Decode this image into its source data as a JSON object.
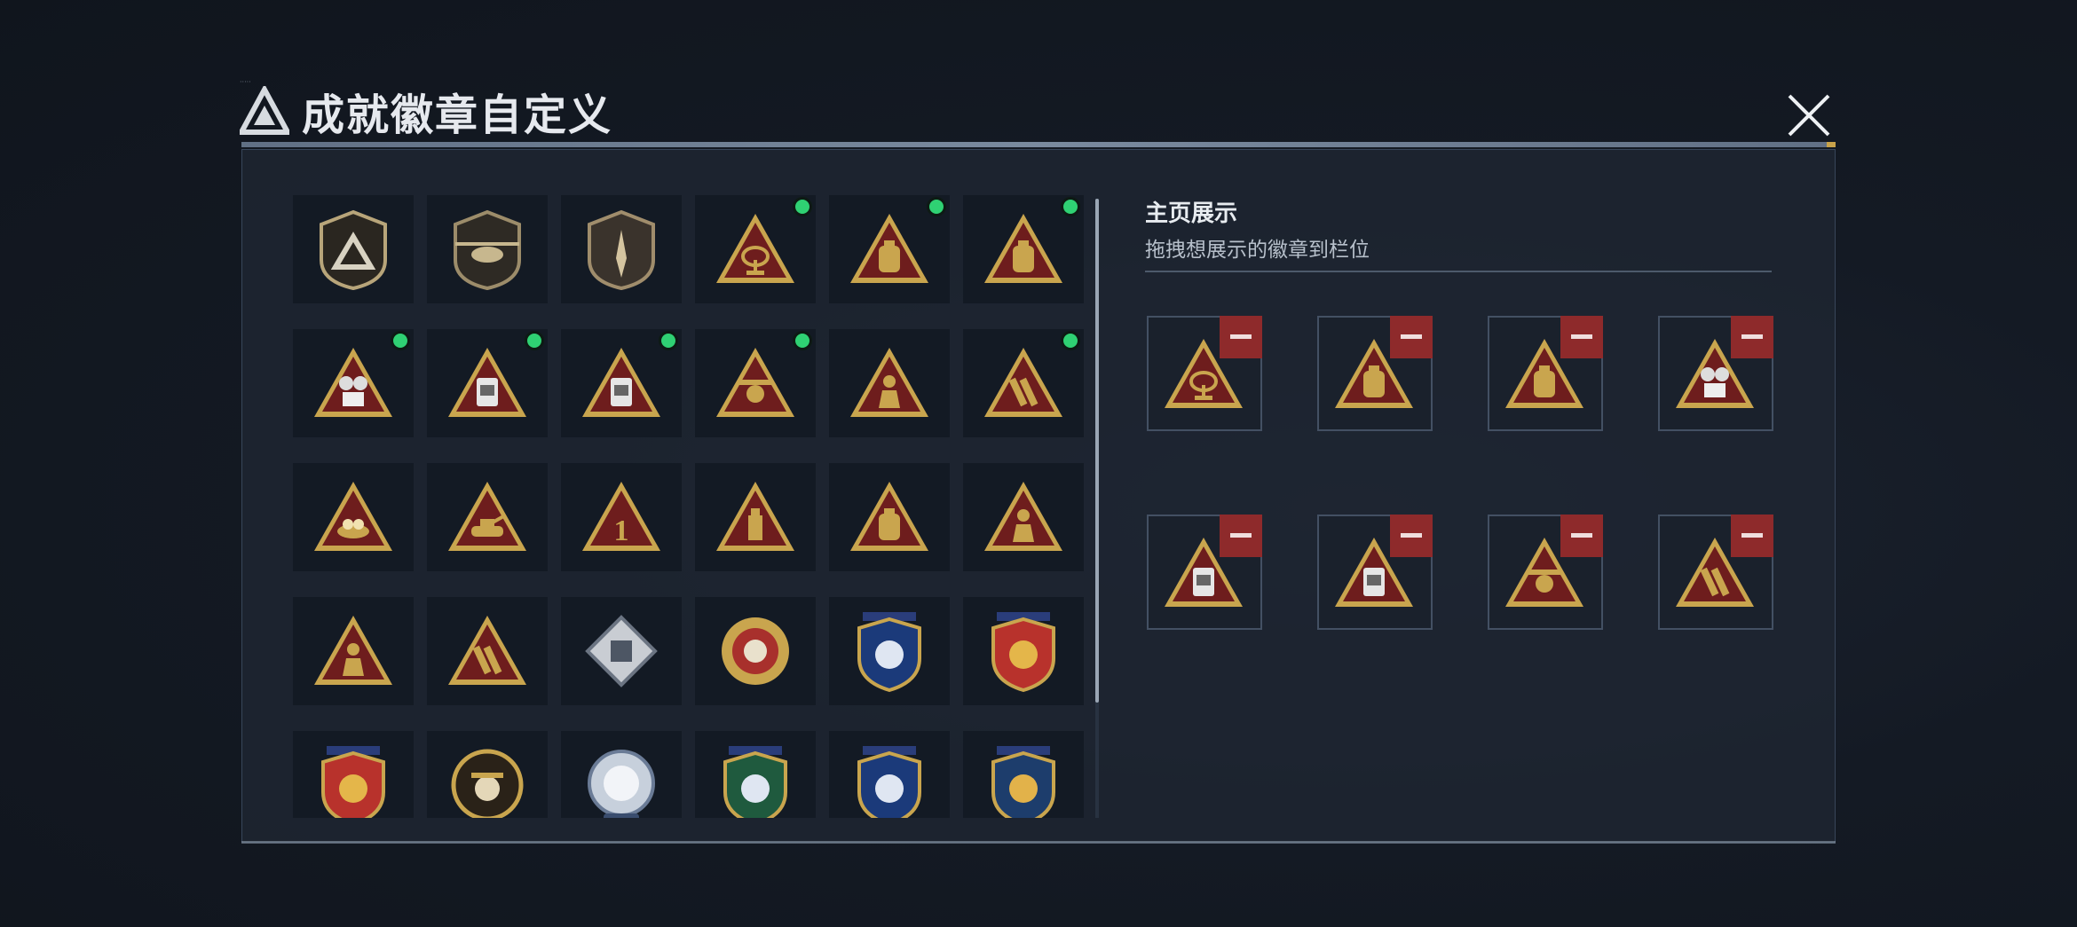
{
  "window": {
    "title": "成就徽章自定义",
    "close_icon": "close-icon"
  },
  "colors": {
    "gold": "#c9a54e",
    "badge_red": "#6e1d1d",
    "new_dot": "#2fd173",
    "remove_red": "#8e2a2b"
  },
  "badges": [
    {
      "icon": "silver-shield-triangle-badge",
      "new": false
    },
    {
      "icon": "helicopter-shield-badge",
      "new": false
    },
    {
      "icon": "dagger-shield-badge",
      "new": false
    },
    {
      "icon": "radar-dish-triangle-badge",
      "new": true
    },
    {
      "icon": "backpack-s4-triangle-badge",
      "new": true
    },
    {
      "icon": "backpack-s5-triangle-badge",
      "new": true
    },
    {
      "icon": "goggles-s6-triangle-badge",
      "new": true
    },
    {
      "icon": "canister-s7-triangle-badge",
      "new": true
    },
    {
      "icon": "robot-s8-triangle-badge",
      "new": true
    },
    {
      "icon": "drone-s9-triangle-badge",
      "new": true
    },
    {
      "icon": "hooded-figure-triangle-badge",
      "new": false
    },
    {
      "icon": "rocket-launcher-triangle-badge",
      "new": true
    },
    {
      "icon": "nest-eggs-triangle-badge",
      "new": false
    },
    {
      "icon": "tank-triangle-badge",
      "new": false
    },
    {
      "icon": "number-one-triangle-badge",
      "new": false
    },
    {
      "icon": "usb-drive-triangle-badge",
      "new": false
    },
    {
      "icon": "lion-bottle-triangle-badge",
      "new": false
    },
    {
      "icon": "kneeling-soldier-triangle-badge",
      "new": false
    },
    {
      "icon": "soldiers-triangle-badge",
      "new": false
    },
    {
      "icon": "missile-triangle-badge",
      "new": false
    },
    {
      "icon": "diamond-tile-badge",
      "new": false
    },
    {
      "icon": "skull-star-medal-badge",
      "new": false
    },
    {
      "icon": "wing-blue-shield-badge",
      "new": false
    },
    {
      "icon": "gold-red-shield-badge",
      "new": false
    },
    {
      "icon": "eagle-red-shield-badge",
      "new": false
    },
    {
      "icon": "cowboy-skull-coin-badge",
      "new": false
    },
    {
      "icon": "skull-blue-crest-badge",
      "new": false
    },
    {
      "icon": "rifle-green-shield-badge",
      "new": false
    },
    {
      "icon": "rifle-blue-shield-badge",
      "new": false
    },
    {
      "icon": "crossed-rifle-gold-shield-badge",
      "new": false
    }
  ],
  "showcase": {
    "title": "主页展示",
    "subtitle": "拖拽想展示的徽章到栏位",
    "slots": [
      {
        "icon": "radar-dish-triangle-badge"
      },
      {
        "icon": "backpack-s4-triangle-badge"
      },
      {
        "icon": "backpack-s5-triangle-badge"
      },
      {
        "icon": "goggles-s6-triangle-badge"
      },
      {
        "icon": "canister-s7-triangle-badge"
      },
      {
        "icon": "robot-s8-triangle-badge"
      },
      {
        "icon": "drone-s9-triangle-badge"
      },
      {
        "icon": "rocket-launcher-triangle-badge"
      }
    ]
  }
}
